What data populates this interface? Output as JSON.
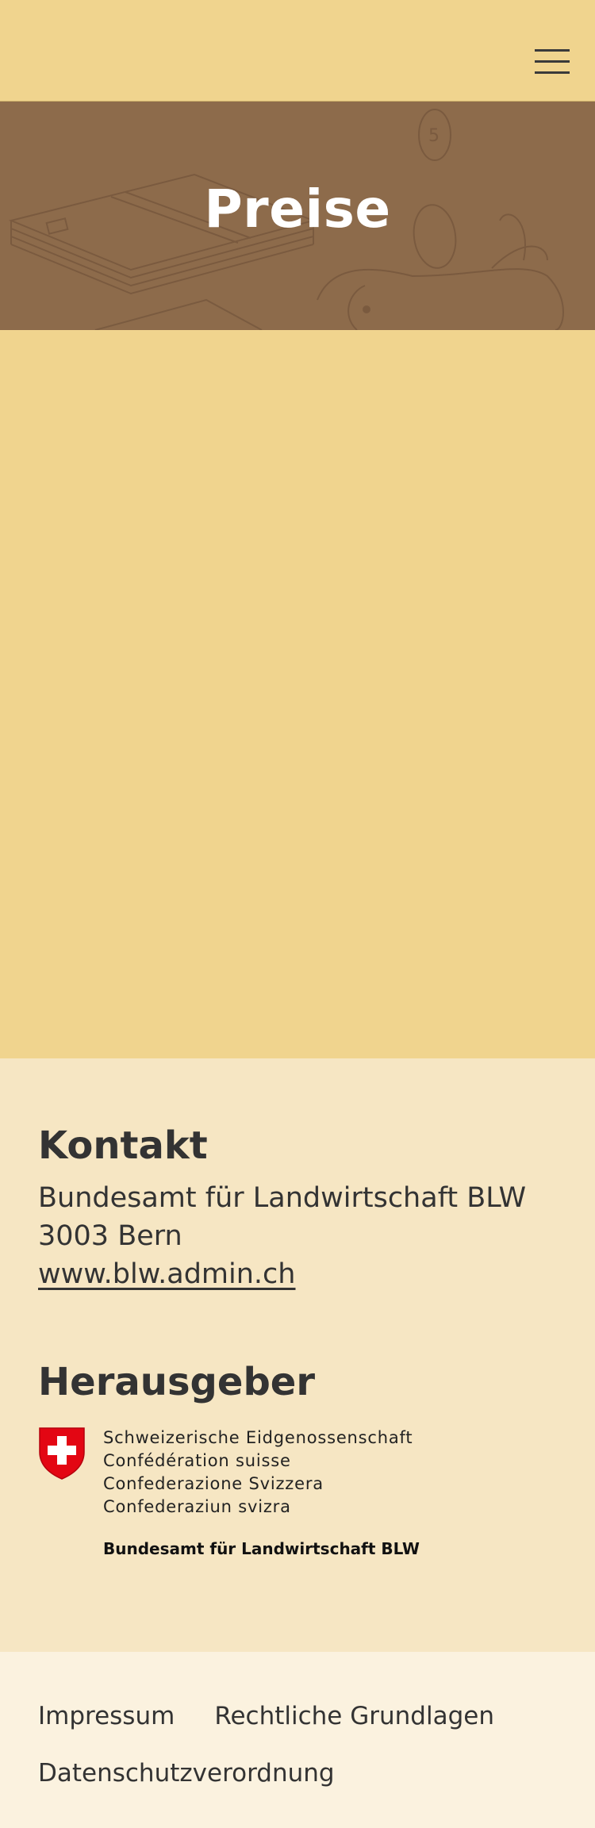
{
  "header": {
    "menu_icon": "hamburger-menu-icon"
  },
  "hero": {
    "title": "Preise",
    "background_color": "#8d6b4b"
  },
  "contact": {
    "heading": "Kontakt",
    "office": "Bundesamt für Landwirtschaft BLW",
    "city": "3003 Bern",
    "website": "www.blw.admin.ch"
  },
  "publisher": {
    "heading": "Herausgeber",
    "logo_lines": [
      "Schweizerische Eidgenossenschaft",
      "Confédération suisse",
      "Confederazione Svizzera",
      "Confederaziun svizra"
    ],
    "office": "Bundesamt für Landwirtschaft BLW"
  },
  "footer_links": [
    "Impressum",
    "Rechtliche Grundlagen",
    "Datenschutzverordnung"
  ],
  "colors": {
    "page_background": "#f0d48e",
    "footer_background": "#f6e6c3",
    "bottom_bar_background": "#fbf2df",
    "swiss_red": "#e30613"
  }
}
